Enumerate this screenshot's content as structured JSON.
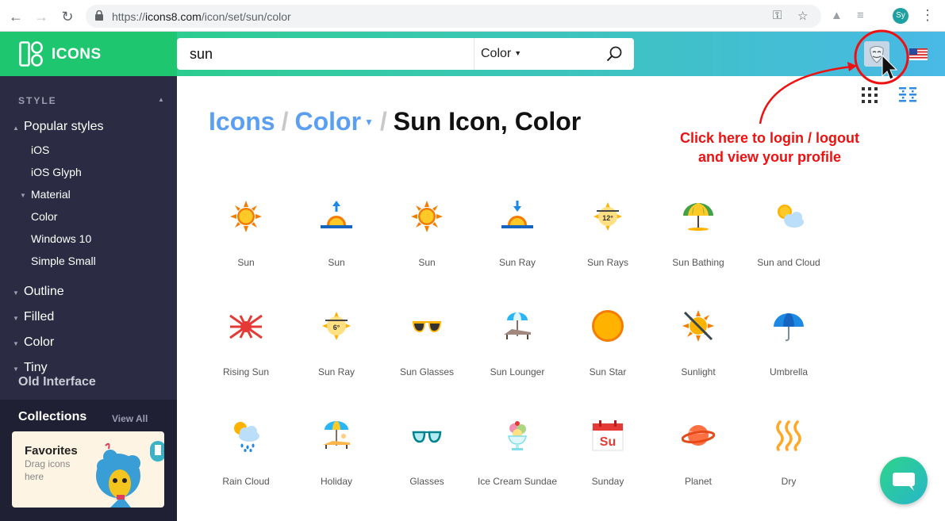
{
  "browser": {
    "url_prefix": "https://",
    "url_domain": "icons8.com",
    "url_path": "/icon/set/sun/color",
    "profile_initials": "Sy"
  },
  "header": {
    "brand": "ICONS",
    "search_value": "sun",
    "style_select": "Color",
    "colors": {
      "green": "#22d07a",
      "blue": "#49b9e6"
    }
  },
  "sidebar": {
    "section": "STYLE",
    "popular": "Popular styles",
    "popular_items": [
      "iOS",
      "iOS Glyph",
      "Material",
      "Color",
      "Windows 10",
      "Simple Small"
    ],
    "groups": [
      "Outline",
      "Filled",
      "Color",
      "Tiny"
    ],
    "old_interface": "Old Interface",
    "collections_title": "Collections",
    "view_all": "View All",
    "favorites_title": "Favorites",
    "favorites_hint": "Drag icons here"
  },
  "breadcrumb": {
    "icons": "Icons",
    "color": "Color",
    "current": "Sun Icon, Color"
  },
  "icons": [
    {
      "label": "Sun",
      "icon": "sun-icon"
    },
    {
      "label": "Sun",
      "icon": "sunrise-icon"
    },
    {
      "label": "Sun",
      "icon": "sun-icon"
    },
    {
      "label": "Sun Ray",
      "icon": "sunset-icon"
    },
    {
      "label": "Sun Rays",
      "icon": "sun-temperature-icon",
      "badge": "12°"
    },
    {
      "label": "Sun Bathing",
      "icon": "beach-umbrella-icon"
    },
    {
      "label": "Sun and Cloud",
      "icon": "partly-cloudy-icon"
    },
    {
      "label": "Rising Sun",
      "icon": "rising-sun-flag-icon"
    },
    {
      "label": "Sun Ray",
      "icon": "sun-temperature-icon",
      "badge": "6°"
    },
    {
      "label": "Sun Glasses",
      "icon": "sunglasses-icon"
    },
    {
      "label": "Sun Lounger",
      "icon": "sun-lounger-icon"
    },
    {
      "label": "Sun Star",
      "icon": "sun-star-icon"
    },
    {
      "label": "Sunlight",
      "icon": "no-sun-icon"
    },
    {
      "label": "Umbrella",
      "icon": "umbrella-icon"
    },
    {
      "label": "Rain Cloud",
      "icon": "rain-cloud-icon"
    },
    {
      "label": "Holiday",
      "icon": "holiday-icon"
    },
    {
      "label": "Glasses",
      "icon": "glasses-icon"
    },
    {
      "label": "Ice Cream Sundae",
      "icon": "ice-cream-icon"
    },
    {
      "label": "Sunday",
      "icon": "calendar-icon",
      "badge": "Su"
    },
    {
      "label": "Planet",
      "icon": "planet-icon"
    },
    {
      "label": "Dry",
      "icon": "heat-waves-icon"
    }
  ],
  "annotation": {
    "line1": "Click here to login / logout",
    "line2": "and view your profile",
    "color": "#ee1111"
  }
}
